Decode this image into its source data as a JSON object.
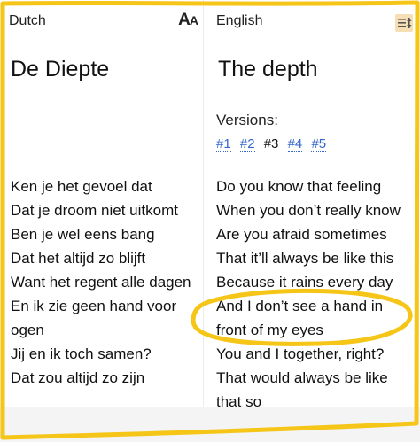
{
  "left": {
    "language": "Dutch",
    "text_size_icon": "text-size-icon",
    "title": "De Diepte",
    "lines": [
      "Ken je het gevoel dat",
      "Dat je droom niet uitkomt",
      "Ben je wel eens bang",
      "Dat het altijd zo blijft",
      "Want het regent alle dagen",
      "En ik zie geen hand voor",
      "ogen",
      "Jij en ik toch samen?",
      "Dat zou altijd zo zijn"
    ]
  },
  "right": {
    "language": "English",
    "menu_icon": "menu-icon",
    "title": "The depth",
    "versions_label": "Versions:",
    "versions": [
      "#1",
      "#2",
      "#3",
      "#4",
      "#5"
    ],
    "current_version": "#3",
    "lines": [
      "Do you know that feeling",
      "When you don’t really know",
      "Are you afraid sometimes",
      "That it’ll always be like this",
      "Because it rains every day",
      "And I don’t see a hand in",
      "front of my eyes",
      "You and I together, right?",
      "That would always be like",
      "that so"
    ]
  },
  "annotation_color": "#f5c518"
}
